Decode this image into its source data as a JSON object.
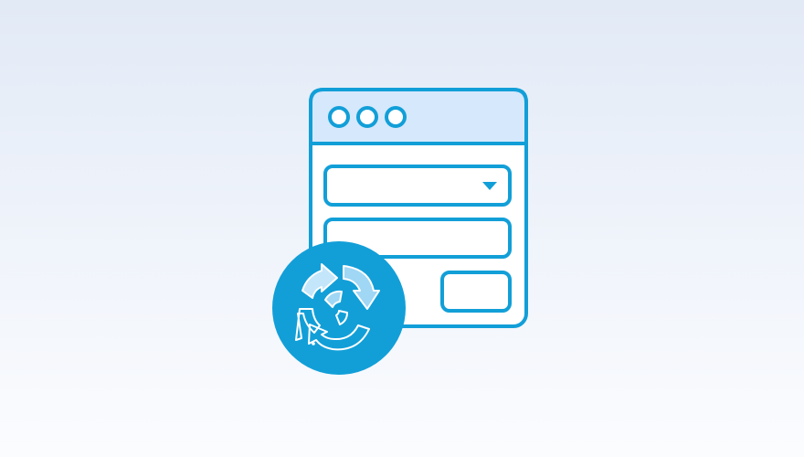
{
  "illustration": {
    "icons": [
      "browser-window-icon",
      "window-dots-icon",
      "dropdown-field-icon",
      "chevron-down-icon",
      "text-field-icon",
      "button-icon",
      "refresh-cycle-icon"
    ]
  },
  "colors": {
    "background_top": "#e2eaf6",
    "background_bottom": "#fbfcfe",
    "stroke": "#129fd8",
    "window_header_fill": "#d6e8fb",
    "window_fill": "#ffffff",
    "badge_fill": "#129fd8",
    "cycle_light_fill": "#9fd7f5",
    "cycle_lighter_fill": "#c3e6fa",
    "cycle_stroke": "#ffffff"
  }
}
